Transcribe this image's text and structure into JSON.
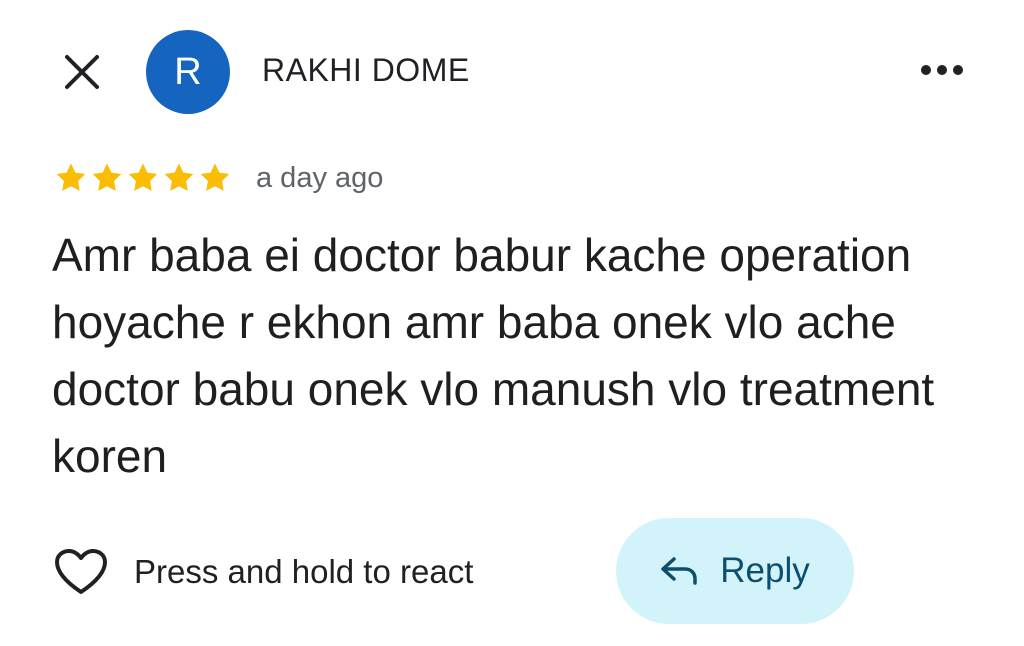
{
  "header": {
    "close_icon": "close-icon",
    "avatar_initial": "R",
    "avatar_color": "#1565c0",
    "author_name": "RAKHI DOME",
    "more_icon": "more-horizontal-icon"
  },
  "review": {
    "rating": 5,
    "rating_max": 5,
    "star_color": "#fbbc04",
    "time": "a day ago",
    "text": "Amr baba ei doctor babur kache operation hoyache r ekhon amr baba onek vlo ache doctor babu onek vlo manush vlo treatment koren"
  },
  "actions": {
    "react_icon": "heart-outline-icon",
    "react_label": "Press and hold to react",
    "reply_icon": "reply-arrow-icon",
    "reply_label": "Reply",
    "reply_bg_color": "#d3f3fb"
  }
}
